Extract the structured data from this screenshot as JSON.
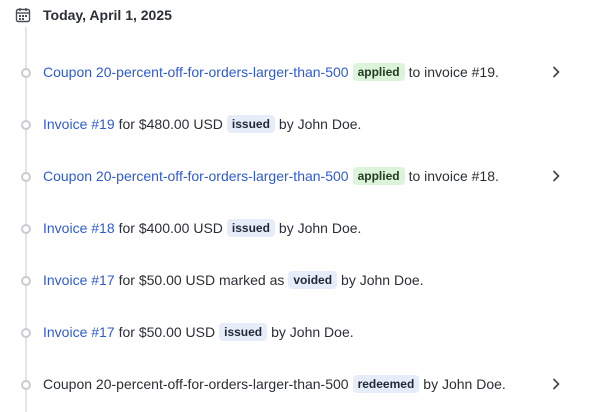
{
  "header": {
    "date_label": "Today, April 1, 2025",
    "icon": "calendar-icon"
  },
  "colors": {
    "link": "#2f5bd3",
    "applied_badge": "#dcf3dc",
    "status_badge": "#e6edf9",
    "rail": "#e3e5e8"
  },
  "events": [
    {
      "link": "Coupon 20-percent-off-for-orders-larger-than-500",
      "badge": "applied",
      "text": "to invoice #19."
    },
    {
      "link": "Invoice #19",
      "text1": "for $480.00 USD",
      "badge": "issued",
      "text2": "by John Doe."
    },
    {
      "link": "Coupon 20-percent-off-for-orders-larger-than-500",
      "badge": "applied",
      "text": "to invoice #18."
    },
    {
      "link": "Invoice #18",
      "text1": "for $400.00 USD",
      "badge": "issued",
      "text2": "by John Doe."
    },
    {
      "link": "Invoice #17",
      "text1": "for $50.00 USD marked as",
      "badge": "voided",
      "text2": "by John Doe."
    },
    {
      "link": "Invoice #17",
      "text1": "for $50.00 USD",
      "badge": "issued",
      "text2": "by John Doe."
    },
    {
      "text1": "Coupon 20-percent-off-for-orders-larger-than-500",
      "badge": "redeemed",
      "text2": "by John Doe."
    }
  ]
}
